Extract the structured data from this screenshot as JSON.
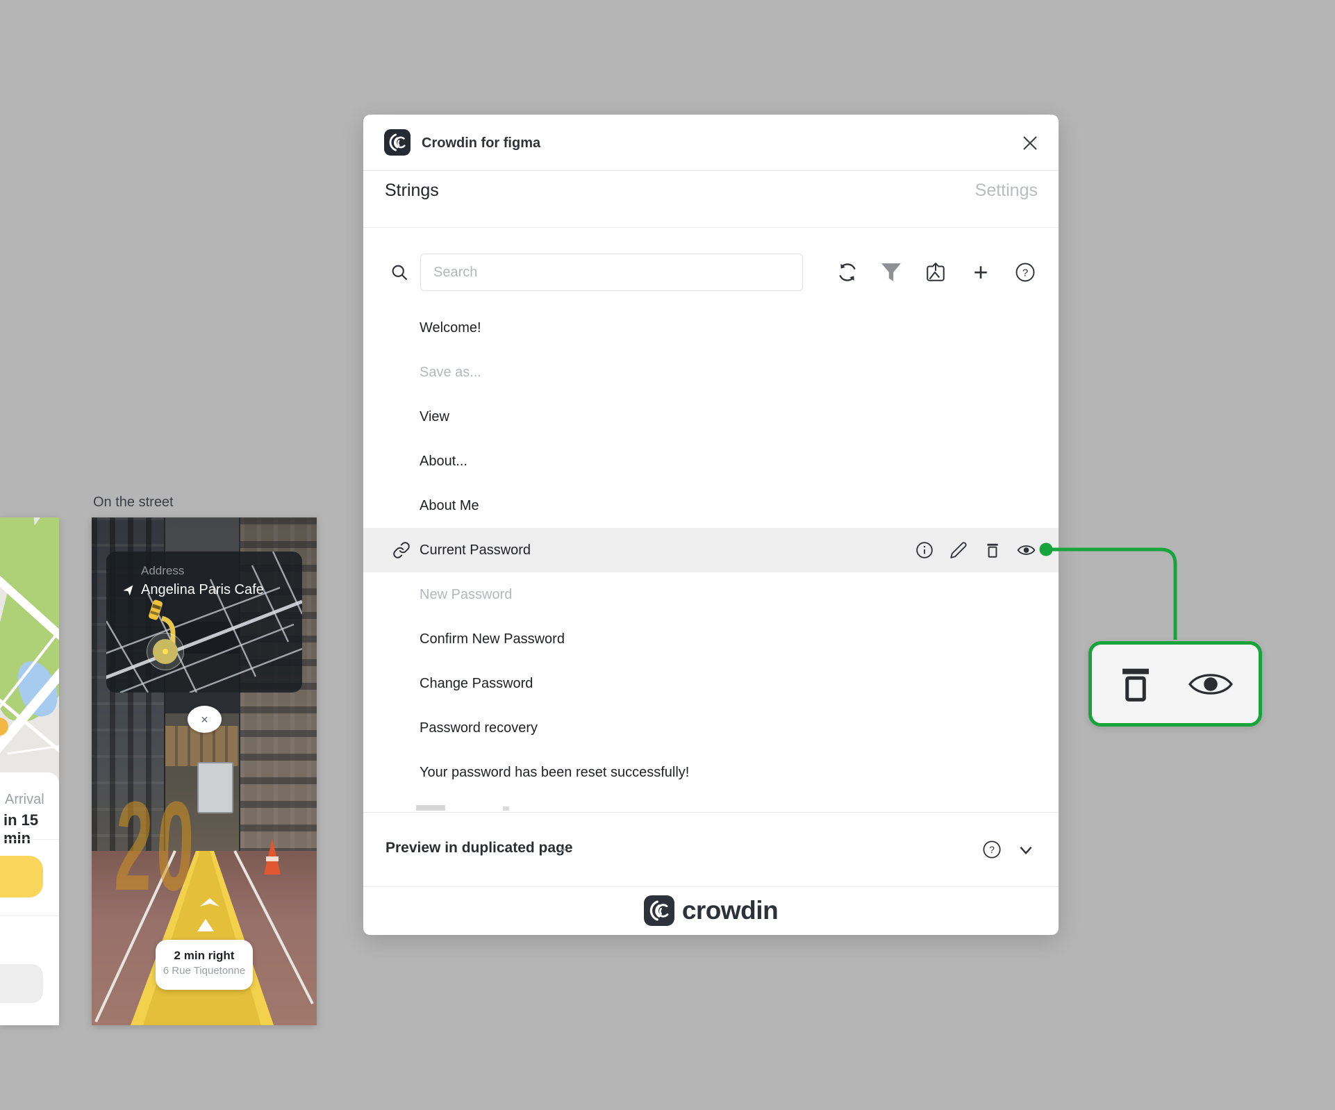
{
  "canvas": {
    "background": "#b5b5b5"
  },
  "figma_frames": {
    "map_frame_partial": {
      "arrival_label": "Arrival",
      "arrival_time": "in 15 min"
    },
    "street_frame": {
      "title": "On the street",
      "address_card": {
        "label": "Address",
        "value": "Angelina Paris Cafe"
      },
      "close_glyph": "×",
      "road_number": "20",
      "direction_card": {
        "primary": "2 min right",
        "secondary": "6 Rue Tiquetonne"
      }
    }
  },
  "plugin": {
    "header": {
      "title": "Crowdin for figma"
    },
    "tabs": {
      "strings": "Strings",
      "settings": "Settings"
    },
    "toolbar": {
      "search_placeholder": "Search",
      "plus_glyph": "+",
      "help_glyph": "?"
    },
    "strings_list": [
      {
        "label": "Welcome!"
      },
      {
        "label": "Save as..."
      },
      {
        "label": "View"
      },
      {
        "label": "About..."
      },
      {
        "label": "About Me"
      },
      {
        "label": "Current Password"
      },
      {
        "label": "New Password"
      },
      {
        "label": "Confirm New Password"
      },
      {
        "label": "Change Password"
      },
      {
        "label": "Password recovery"
      },
      {
        "label": "Your password has been reset successfully!"
      }
    ],
    "selected_row": "Current Password",
    "footer": {
      "preview_label": "Preview in duplicated page",
      "help_glyph": "?"
    },
    "brand": {
      "wordmark": "crowdin"
    }
  },
  "callout": {
    "description": "magnified trash and eye row actions"
  },
  "colors": {
    "accent_green": "#18a43c",
    "row_highlight": "#efefef",
    "muted_text": "#b4b7bb",
    "brand_dark": "#2c313a",
    "path_yellow": "#edc83f",
    "button_yellow": "#f8d65c"
  }
}
